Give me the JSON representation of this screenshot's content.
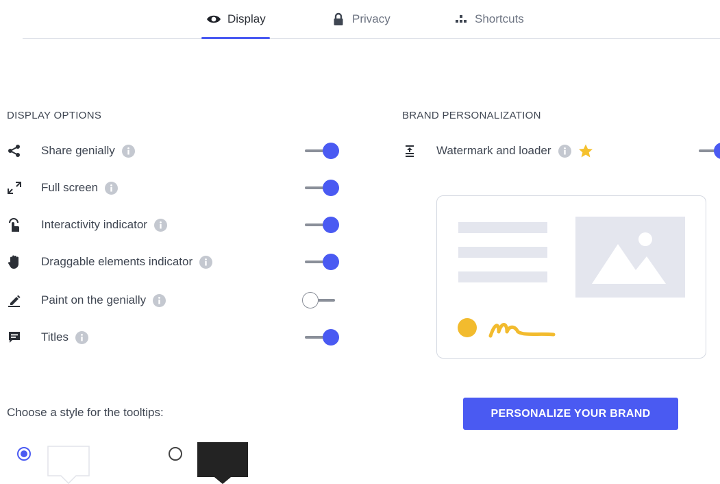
{
  "tabs": [
    {
      "label": "Display",
      "icon": "eye-icon",
      "active": true
    },
    {
      "label": "Privacy",
      "icon": "lock-icon",
      "active": false
    },
    {
      "label": "Shortcuts",
      "icon": "shortcuts-icon",
      "active": false
    }
  ],
  "display_options": {
    "title": "DISPLAY OPTIONS",
    "items": [
      {
        "label": "Share genially",
        "icon": "share-icon",
        "enabled": true
      },
      {
        "label": "Full screen",
        "icon": "fullscreen-icon",
        "enabled": true
      },
      {
        "label": "Interactivity indicator",
        "icon": "tap-icon",
        "enabled": true
      },
      {
        "label": "Draggable elements indicator",
        "icon": "hand-icon",
        "enabled": true
      },
      {
        "label": "Paint on the genially",
        "icon": "pencil-icon",
        "enabled": false
      },
      {
        "label": "Titles",
        "icon": "title-icon",
        "enabled": true
      }
    ]
  },
  "brand": {
    "title": "BRAND PERSONALIZATION",
    "watermark_label": "Watermark and loader",
    "watermark_enabled": true,
    "button_label": "PERSONALIZE YOUR BRAND"
  },
  "tooltips": {
    "label": "Choose a style for the tooltips:",
    "options": [
      {
        "style": "light",
        "selected": true
      },
      {
        "style": "dark",
        "selected": false
      }
    ]
  },
  "colors": {
    "accent": "#4a5af2",
    "placeholder": "#e4e6ee",
    "brand_yellow": "#f2bb2e",
    "star": "#f5c12e"
  }
}
